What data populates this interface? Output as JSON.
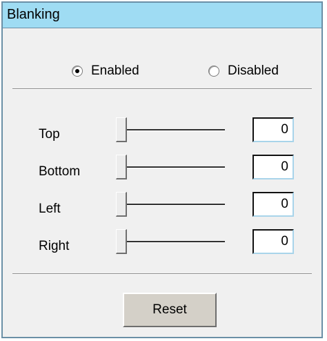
{
  "panel": {
    "title": "Blanking"
  },
  "mode": {
    "enabled_label": "Enabled",
    "disabled_label": "Disabled",
    "selected": "Enabled"
  },
  "rows": [
    {
      "label": "Top",
      "value": "0"
    },
    {
      "label": "Bottom",
      "value": "0"
    },
    {
      "label": "Left",
      "value": "0"
    },
    {
      "label": "Right",
      "value": "0"
    }
  ],
  "reset_label": "Reset",
  "colors": {
    "titlebar": "#9fdcf3",
    "panel_border": "#6a8fa6",
    "panel_background": "#f0f0f0",
    "button_face": "#d4d0c8"
  }
}
